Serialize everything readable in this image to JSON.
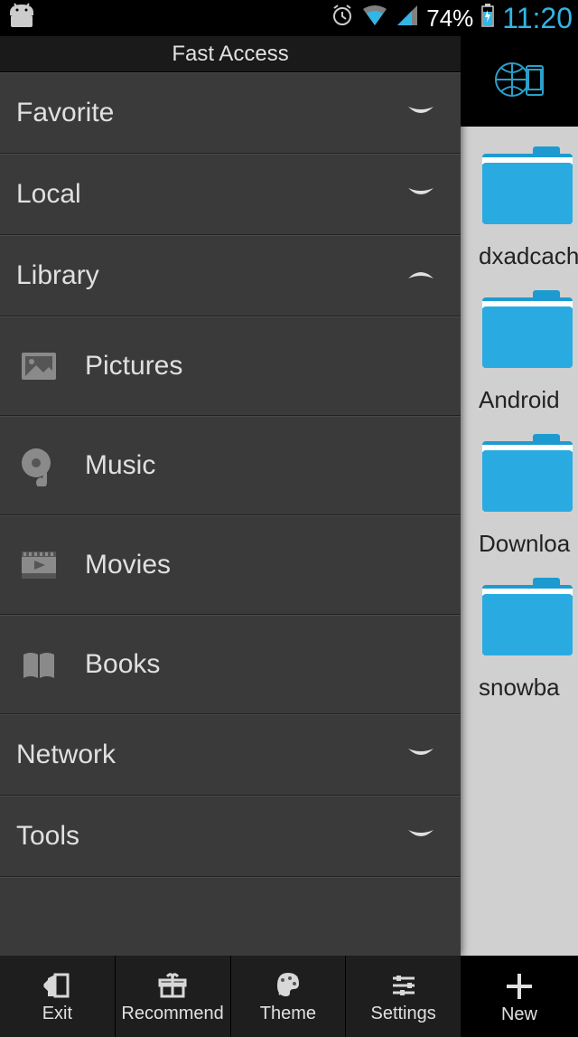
{
  "status": {
    "battery_pct": "74%",
    "time": "11:20"
  },
  "drawer": {
    "title": "Fast Access",
    "sections": {
      "favorite": "Favorite",
      "local": "Local",
      "library": "Library",
      "network": "Network",
      "tools": "Tools"
    },
    "library_items": {
      "pictures": "Pictures",
      "music": "Music",
      "movies": "Movies",
      "books": "Books"
    }
  },
  "content": {
    "folders": [
      {
        "label": "dxadcach"
      },
      {
        "label": "Android"
      },
      {
        "label": "Downloa"
      },
      {
        "label": "snowba"
      }
    ]
  },
  "bottombar": {
    "exit": "Exit",
    "recommend": "Recommend",
    "theme": "Theme",
    "settings": "Settings",
    "new": "New"
  }
}
